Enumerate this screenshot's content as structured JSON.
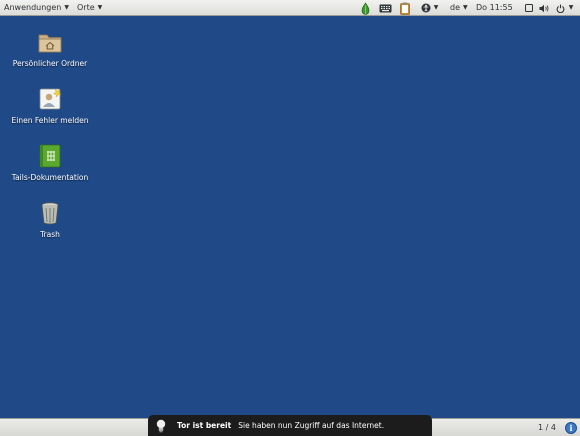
{
  "top_panel": {
    "applications_menu": "Anwendungen",
    "places_menu": "Orte",
    "keyboard_layout": "de",
    "clock": "Do 11:55"
  },
  "desktop": {
    "icons": [
      {
        "label": "Persönlicher Ordner",
        "icon": "home-folder-icon"
      },
      {
        "label": "Einen Fehler melden",
        "icon": "bug-report-icon"
      },
      {
        "label": "Tails-Dokumentation",
        "icon": "documentation-icon"
      },
      {
        "label": "Trash",
        "icon": "trash-icon"
      }
    ]
  },
  "notification": {
    "title": "Tor ist bereit",
    "message": "Sie haben nun Zugriff auf das Internet."
  },
  "bottom_panel": {
    "workspace_indicator": "1 / 4"
  },
  "colors": {
    "desktop_background": "#1f4987",
    "panel": "#e4e4e0",
    "notification_background": "#1c1c1c",
    "tor_onion": "#3a9a2a"
  }
}
